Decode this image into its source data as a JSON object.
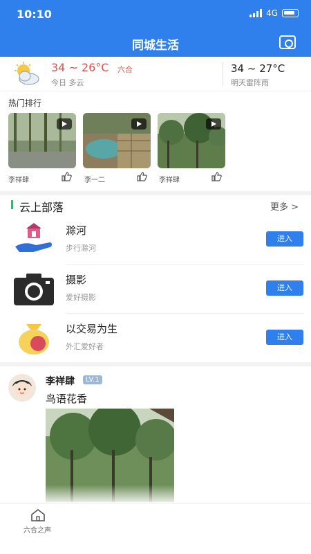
{
  "status": {
    "time": "10:10",
    "network": "4G"
  },
  "header": {
    "title": "同城生活"
  },
  "weather": {
    "today_temp": "34 ~ 26°C",
    "location": "六合",
    "today_desc": "今日 多云",
    "tomorrow_temp": "34 ~ 27°C",
    "tomorrow_desc": "明天雷阵雨"
  },
  "hot": {
    "title": "热门排行",
    "items": [
      {
        "name": "李祥肆"
      },
      {
        "name": "李一二"
      },
      {
        "name": "李祥肆"
      }
    ]
  },
  "tribes": {
    "title": "云上部落",
    "more": "更多 >",
    "items": [
      {
        "name": "滁河",
        "sub": "步行滁河",
        "button": "进入"
      },
      {
        "name": "摄影",
        "sub": "爱好摄影",
        "button": "进入"
      },
      {
        "name": "以交易为生",
        "sub": "外汇爱好者",
        "button": "进入"
      }
    ]
  },
  "post": {
    "user": "李祥肆",
    "level": "LV.1",
    "text": "鸟语花香"
  },
  "tabbar": {
    "label": "六合之声"
  },
  "colors": {
    "primary": "#2f80ed",
    "accent_green": "#3cb371",
    "temp_red": "#d9534f"
  }
}
